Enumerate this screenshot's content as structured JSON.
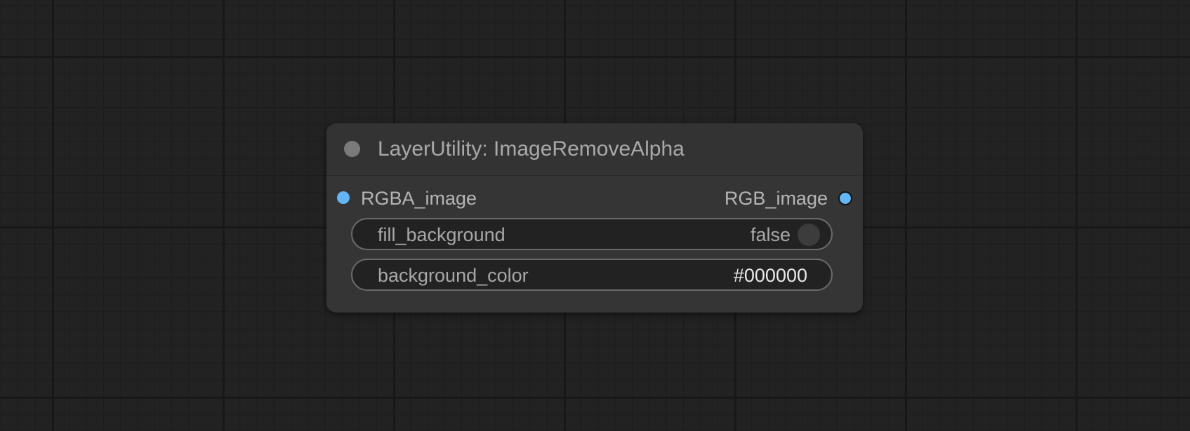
{
  "node": {
    "title": "LayerUtility: ImageRemoveAlpha",
    "inputs": [
      {
        "label": "RGBA_image",
        "color": "#64b5f6"
      }
    ],
    "outputs": [
      {
        "label": "RGB_image",
        "color": "#64b5f6"
      }
    ],
    "widgets": {
      "fill_background": {
        "label": "fill_background",
        "value": "false"
      },
      "background_color": {
        "label": "background_color",
        "value": "#000000"
      }
    }
  },
  "theme": {
    "canvas_bg": "#222222",
    "node_bg": "#353535",
    "slot_color": "#64b5f6"
  }
}
